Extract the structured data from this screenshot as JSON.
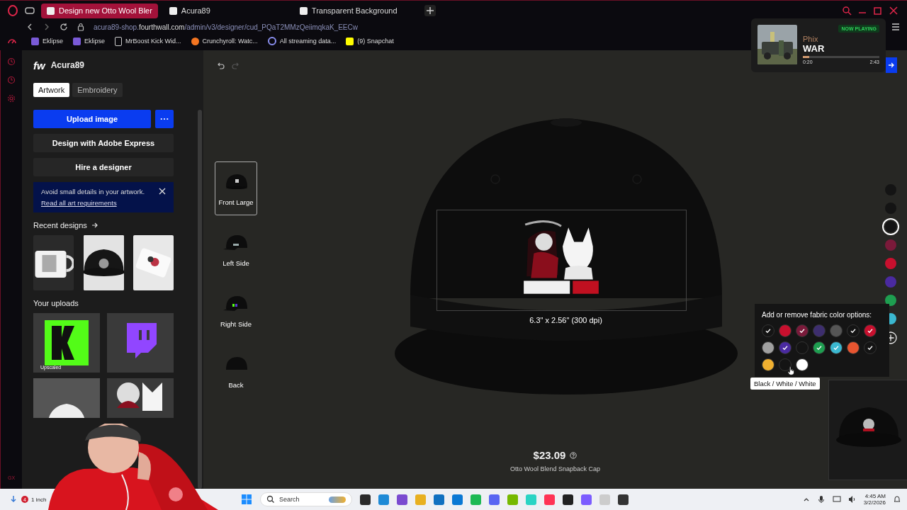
{
  "browser": {
    "tabs": [
      {
        "title": "Design new Otto Wool Bler",
        "selected": true
      },
      {
        "title": "Acura89",
        "selected": false
      },
      {
        "title": "Transparent Background",
        "selected": false
      }
    ],
    "address_host": "acura89-shop.",
    "address_domain": "fourthwall.com",
    "address_path": "/admin/v3/designer/cud_PQaT2MMzQeiimqkaK_EECw",
    "bookmarks": [
      {
        "label": "Eklipse",
        "kind": "app"
      },
      {
        "label": "Eklipse",
        "kind": "app"
      },
      {
        "label": "MrBoost Kick Wid...",
        "kind": "page"
      },
      {
        "label": "Crunchyroll: Watc...",
        "kind": "crunchy"
      },
      {
        "label": "All streaming data...",
        "kind": "stream"
      },
      {
        "label": "(9) Snapchat",
        "kind": "snap"
      }
    ],
    "sidebar_label": "GX"
  },
  "designer": {
    "logo": "fw",
    "store": "Acura89",
    "mode_tabs": [
      {
        "label": "Artwork",
        "selected": true
      },
      {
        "label": "Embroidery",
        "selected": false
      }
    ],
    "upload_button": "Upload image",
    "adobe_button": "Design with Adobe Express",
    "hire_button": "Hire a designer",
    "notice": {
      "text": "Avoid small details in your artwork.",
      "link": "Read all art requirements"
    },
    "recent_title": "Recent designs",
    "recent_designs": [
      {
        "kind": "picture"
      },
      {
        "kind": "picture"
      },
      {
        "kind": "picture"
      }
    ],
    "uploads_title": "Your uploads",
    "uploads": [
      {
        "kind": "picture",
        "label": "Upscaled"
      },
      {
        "kind": "picture"
      },
      {
        "kind": "picture"
      },
      {
        "kind": "picture"
      }
    ],
    "redo_disabled": true,
    "views": [
      {
        "label": "Front Large",
        "selected": true
      },
      {
        "label": "Left Side",
        "selected": false
      },
      {
        "label": "Right Side",
        "selected": false
      },
      {
        "label": "Back",
        "selected": false
      }
    ],
    "print_size": "6.3\" x 2.56\" (300 dpi)",
    "price": "$23.09",
    "product": "Otto Wool Blend Snapback Cap",
    "product_colors": [
      {
        "color": "#141414",
        "selected": false
      },
      {
        "color": "#141414",
        "selected": false
      },
      {
        "color": "#141414",
        "selected": true
      },
      {
        "color": "#7a1a3a",
        "selected": false
      },
      {
        "color": "#c8102e",
        "selected": false
      },
      {
        "color": "#4a2aa0",
        "selected": false
      },
      {
        "color": "#1e9e50",
        "selected": false
      },
      {
        "color": "#3bb8d0",
        "selected": false
      }
    ],
    "fabric_popover": {
      "title": "Add or remove fabric color options:",
      "swatches": [
        {
          "color": "#141414",
          "checked": true
        },
        {
          "color": "#c8102e",
          "checked": false
        },
        {
          "color": "#7a1a3a",
          "checked": true
        },
        {
          "color": "#3d2e6e",
          "checked": false
        },
        {
          "color": "#555555",
          "checked": false
        },
        {
          "color": "#141414",
          "checked": true
        },
        {
          "color": "#c8102e",
          "checked": true
        },
        {
          "color": "#a0a0a0",
          "checked": false
        },
        {
          "color": "#4a2aa0",
          "checked": true
        },
        {
          "color": "#141414",
          "checked": false
        },
        {
          "color": "#1e9e50",
          "checked": true
        },
        {
          "color": "#3bb8d0",
          "checked": true
        },
        {
          "color": "#e85530",
          "checked": false
        },
        {
          "color": "#141414",
          "checked": true
        },
        {
          "color": "#f0b030",
          "checked": false
        },
        {
          "color": "#141414",
          "checked": false
        },
        {
          "color": "#ffffff",
          "checked": false
        }
      ],
      "tooltip": "Black / White / White"
    }
  },
  "now_playing": {
    "badge": "NOW PLAYING",
    "artist": "Phix",
    "title": "WAR",
    "level": 0.08,
    "elapsed": "0:20",
    "duration": "2:43"
  },
  "taskbar": {
    "weather_badge": "4",
    "weather": "1 inch",
    "search_placeholder": "Search",
    "time": "4:45 AM",
    "date": "3/2/2026"
  }
}
